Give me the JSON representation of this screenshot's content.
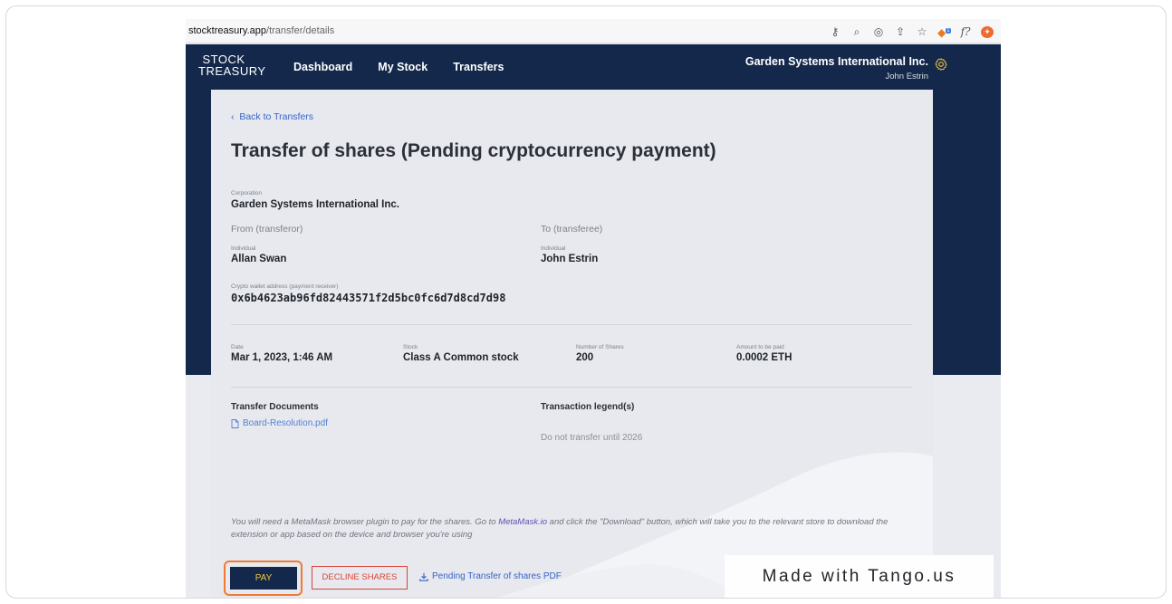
{
  "browser": {
    "url_domain": "stocktreasury.app",
    "url_path": "/transfer/details",
    "extension_badge": "1",
    "extension_f_label": "f?"
  },
  "header": {
    "logo_line1": "STOCK",
    "logo_line2": "TREASURY",
    "nav": [
      {
        "label": "Dashboard"
      },
      {
        "label": "My Stock"
      },
      {
        "label": "Transfers"
      }
    ],
    "org_name": "Garden Systems International Inc.",
    "user_name": "John Estrin"
  },
  "page": {
    "back_link": "Back to Transfers",
    "title": "Transfer of shares (Pending cryptocurrency payment)",
    "corporation_label": "Corporation",
    "corporation_value": "Garden Systems International Inc.",
    "from_label": "From (transferor)",
    "to_label": "To (transferee)",
    "from_type": "Individual",
    "from_name": "Allan Swan",
    "to_type": "Individual",
    "to_name": "John Estrin",
    "wallet_label": "Crypto wallet address (payment receiver)",
    "wallet_value": "0x6b4623ab96fd82443571f2d5bc0fc6d7d8cd7d98",
    "date_label": "Date",
    "date_value": "Mar 1, 2023, 1:46 AM",
    "stock_label": "Stock",
    "stock_value": "Class A Common stock",
    "shares_label": "Number of Shares",
    "shares_value": "200",
    "amount_label": "Amount to be paid",
    "amount_value": "0.0002 ETH",
    "docs_header": "Transfer Documents",
    "doc_file": "Board-Resolution.pdf",
    "legend_header": "Transaction legend(s)",
    "legend_value": "Do not transfer until 2026",
    "notice_part1": "You will need a MetaMask browser plugin to pay for the shares. Go to ",
    "notice_link": "MetaMask.io",
    "notice_part2": " and click the \"Download\" button, which will take you to the relevant store to download the extension or app based on the device and browser you're using"
  },
  "actions": {
    "pay_label": "PAY",
    "decline_label": "DECLINE SHARES",
    "pdf_label": "Pending Transfer of shares PDF"
  },
  "watermark": {
    "text": "Made with Tango.us"
  },
  "colors": {
    "navy": "#13284a",
    "accent_gold": "#f5c842",
    "link_blue": "#3563c9",
    "danger_red": "#d9443a",
    "highlight_orange": "#f07a35"
  }
}
